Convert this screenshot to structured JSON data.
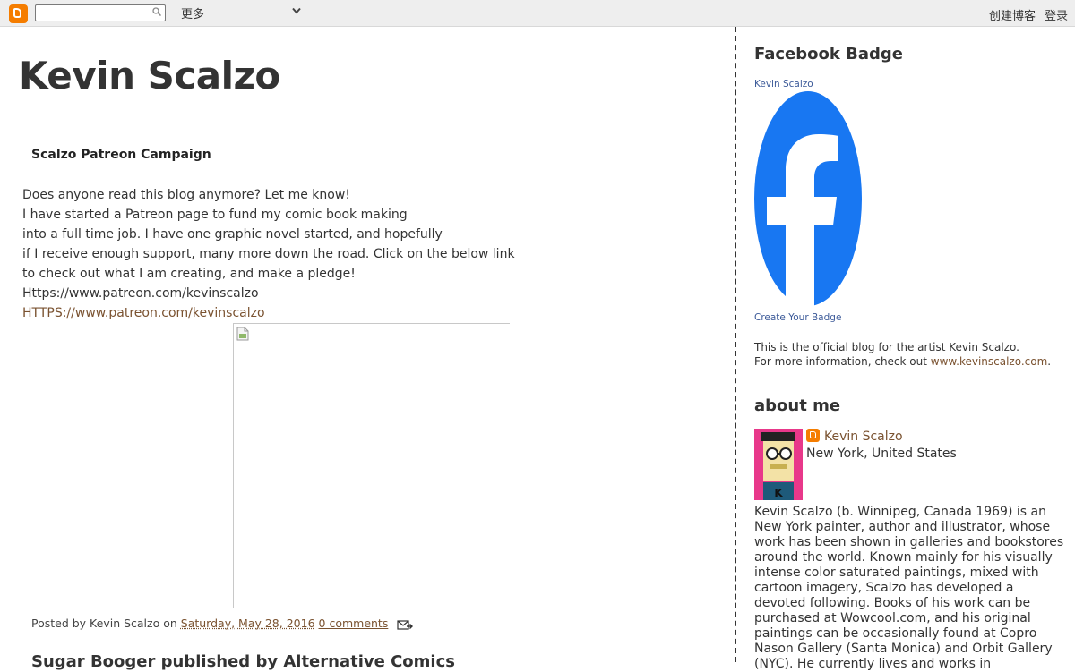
{
  "navbar": {
    "more_label": "更多",
    "create_blog": "创建博客",
    "login": "登录",
    "search_placeholder": ""
  },
  "blog": {
    "title": "Kevin Scalzo"
  },
  "post": {
    "title": "Scalzo Patreon Campaign",
    "lines": [
      "Does anyone read this blog anymore? Let me know!",
      "I have started a Patreon page to fund my comic book making",
      "into a full time job. I have one graphic novel started, and hopefully",
      "if I receive enough support, many more down the road. Click on the below link",
      "to check out what I am creating, and make a pledge!",
      "Https://www.patreon.com/kevinscalzo"
    ],
    "link": "HTTPS://www.patreon.com/kevinscalzo",
    "footer": {
      "posted_by": "Posted by Kevin Scalzo on",
      "date": "Saturday, May 28, 2016",
      "comments": "0 comments"
    }
  },
  "next_post": {
    "title": "Sugar Booger published by Alternative Comics"
  },
  "sidebar": {
    "facebook": {
      "title": "Facebook Badge",
      "name_link": "Kevin Scalzo",
      "create_badge": "Create Your Badge",
      "desc1": "This is the official blog for the artist Kevin Scalzo.",
      "desc2": "For more information, check out",
      "site_link": "www.kevinscalzo.com",
      "period": ".",
      "brand_color": "#1877f2"
    },
    "about": {
      "title": "about me",
      "name": "Kevin Scalzo",
      "location": "New York, United States",
      "bio": "Kevin Scalzo (b. Winnipeg, Canada 1969) is an New York painter, author and illustrator, whose work has been shown in galleries and bookstores around the world. Known mainly for his visually intense color saturated paintings, mixed with cartoon imagery, Scalzo has developed a devoted following. Books of his work can be purchased at Wowcool.com, and his original paintings can be occasionally found at Copro Nason Gallery (Santa Monica) and Orbit Gallery (NYC). He currently lives and works in"
    }
  },
  "colors": {
    "blogger_orange": "#f57d00",
    "link_brown": "#7a5230",
    "navbar_bg": "#eeeeee"
  }
}
